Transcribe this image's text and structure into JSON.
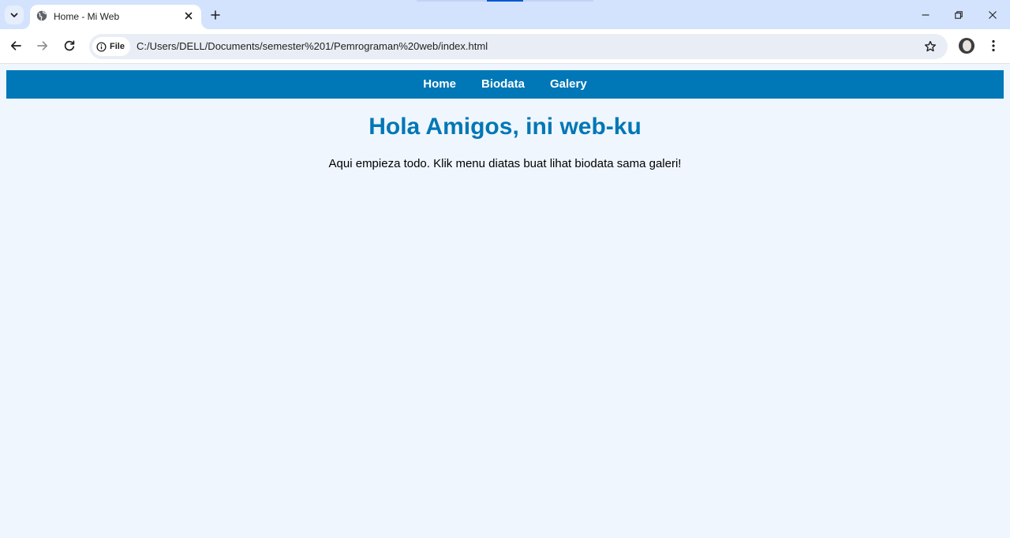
{
  "browser": {
    "tab": {
      "title": "Home - Mi Web"
    },
    "address": {
      "chip_label": "File",
      "url": "C:/Users/DELL/Documents/semester%201/Pemrograman%20web/index.html"
    },
    "icons": [
      "tab-list-icon",
      "globe-icon",
      "close-icon",
      "plus-icon",
      "back-icon",
      "forward-icon",
      "reload-icon",
      "info-icon",
      "star-icon",
      "avatar",
      "more-vert-icon",
      "minimize-icon",
      "restore-icon",
      "window-close-icon"
    ]
  },
  "page": {
    "nav": [
      {
        "label": "Home"
      },
      {
        "label": "Biodata"
      },
      {
        "label": "Galery"
      }
    ],
    "heading": "Hola Amigos, ini web-ku",
    "intro": "Aqui empieza todo. Klik menu diatas buat lihat biodata sama galeri!"
  },
  "colors": {
    "nav_background": "#0077b6",
    "heading": "#0077b6",
    "page_background": "#eff6fd",
    "chrome_titlebar": "#d3e3fd"
  }
}
